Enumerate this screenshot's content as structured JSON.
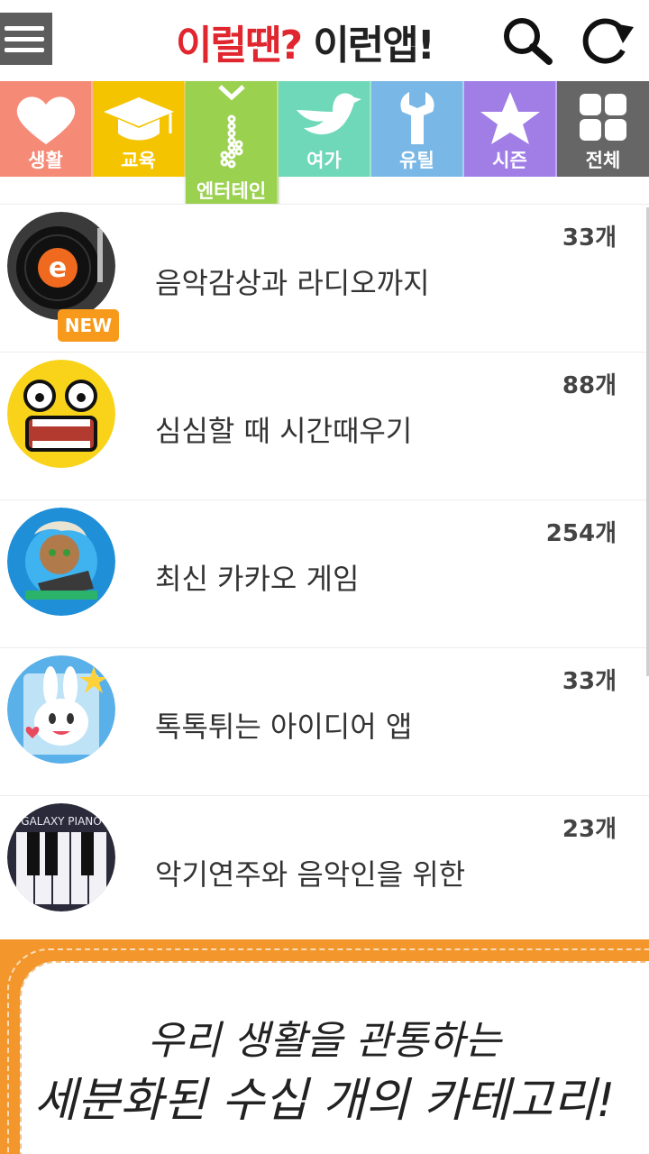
{
  "header": {
    "logo_part1": "이럴땐",
    "logo_q": "?",
    "logo_part2": " 이런앱!",
    "menu_icon": "hamburger-menu-icon",
    "search_icon": "search-icon",
    "refresh_icon": "refresh-icon"
  },
  "tabs": [
    {
      "label": "생활",
      "icon": "heart-icon",
      "color": "#f58a76"
    },
    {
      "label": "교육",
      "icon": "graduation-cap-icon",
      "color": "#f5c400"
    },
    {
      "label": "엔터테인",
      "icon": "music-note-icon",
      "color": "#9ad14f",
      "selected": true
    },
    {
      "label": "여가",
      "icon": "bird-icon",
      "color": "#6ed8b8"
    },
    {
      "label": "유틸",
      "icon": "wrench-icon",
      "color": "#79b8e6"
    },
    {
      "label": "시즌",
      "icon": "star-icon",
      "color": "#a07ee6"
    },
    {
      "label": "전체",
      "icon": "grid-icon",
      "color": "#666666"
    }
  ],
  "list": [
    {
      "title": "음악감상과 라디오까지",
      "count": "33개",
      "badge": "NEW",
      "thumb": "turntable-icon"
    },
    {
      "title": "심심할 때 시간때우기",
      "count": "88개",
      "thumb": "yellow-face-icon"
    },
    {
      "title": "최신 카카오 게임",
      "count": "254개",
      "thumb": "game-character-icon"
    },
    {
      "title": "톡톡튀는 아이디어 앱",
      "count": "33개",
      "thumb": "rabbit-icon"
    },
    {
      "title": "악기연주와 음악인을 위한",
      "count": "23개",
      "thumb": "piano-icon",
      "thumb_text": "GALAXY PIANO"
    }
  ],
  "banner": {
    "line1": "우리 생활을 관통하는",
    "line2": "세분화된 수십 개의 카테고리!"
  }
}
